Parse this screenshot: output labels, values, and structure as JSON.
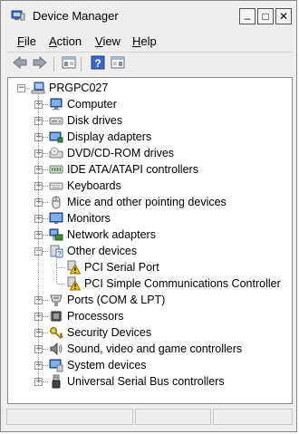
{
  "window": {
    "title": "Device Manager",
    "controls": {
      "minimize": "_",
      "maximize": "□",
      "close": "✕"
    }
  },
  "menu": [
    {
      "label": "File",
      "accel": "F",
      "rest": "ile"
    },
    {
      "label": "Action",
      "accel": "A",
      "rest": "ction"
    },
    {
      "label": "View",
      "accel": "V",
      "rest": "iew"
    },
    {
      "label": "Help",
      "accel": "H",
      "rest": "elp"
    }
  ],
  "toolbar": {
    "icons": [
      "back-arrow-icon",
      "forward-arrow-icon",
      "show-hide-console-tree-icon",
      "properties-icon",
      "help-icon",
      "properties-view-icon"
    ]
  },
  "tree": {
    "root": {
      "label": "PRGPC027",
      "icon": "computer-icon",
      "expanded": true
    },
    "categories": [
      {
        "label": "Computer",
        "icon": "computer-monitor-icon",
        "expanded": false
      },
      {
        "label": "Disk drives",
        "icon": "disk-drive-icon",
        "expanded": false
      },
      {
        "label": "Display adapters",
        "icon": "display-adapter-icon",
        "expanded": false
      },
      {
        "label": "DVD/CD-ROM drives",
        "icon": "dvd-drive-icon",
        "expanded": false
      },
      {
        "label": "IDE ATA/ATAPI controllers",
        "icon": "ide-controller-icon",
        "expanded": false
      },
      {
        "label": "Keyboards",
        "icon": "keyboard-icon",
        "expanded": false
      },
      {
        "label": "Mice and other pointing devices",
        "icon": "mouse-icon",
        "expanded": false
      },
      {
        "label": "Monitors",
        "icon": "monitor-icon",
        "expanded": false
      },
      {
        "label": "Network adapters",
        "icon": "network-adapter-icon",
        "expanded": false
      },
      {
        "label": "Other devices",
        "icon": "unknown-device-icon",
        "expanded": true,
        "children": [
          {
            "label": "PCI Serial Port",
            "icon": "warning-device-icon"
          },
          {
            "label": "PCI Simple Communications Controller",
            "icon": "warning-device-icon"
          }
        ]
      },
      {
        "label": "Ports (COM & LPT)",
        "icon": "port-icon",
        "expanded": false
      },
      {
        "label": "Processors",
        "icon": "processor-icon",
        "expanded": false
      },
      {
        "label": "Security Devices",
        "icon": "security-key-icon",
        "expanded": false
      },
      {
        "label": "Sound, video and game controllers",
        "icon": "speaker-icon",
        "expanded": false
      },
      {
        "label": "System devices",
        "icon": "system-devices-icon",
        "expanded": false
      },
      {
        "label": "Universal Serial Bus controllers",
        "icon": "usb-icon",
        "expanded": false
      }
    ]
  },
  "colors": {
    "chrome": "#eeeeee",
    "tree_background": "#ffffff",
    "warning": "#f5c400"
  }
}
